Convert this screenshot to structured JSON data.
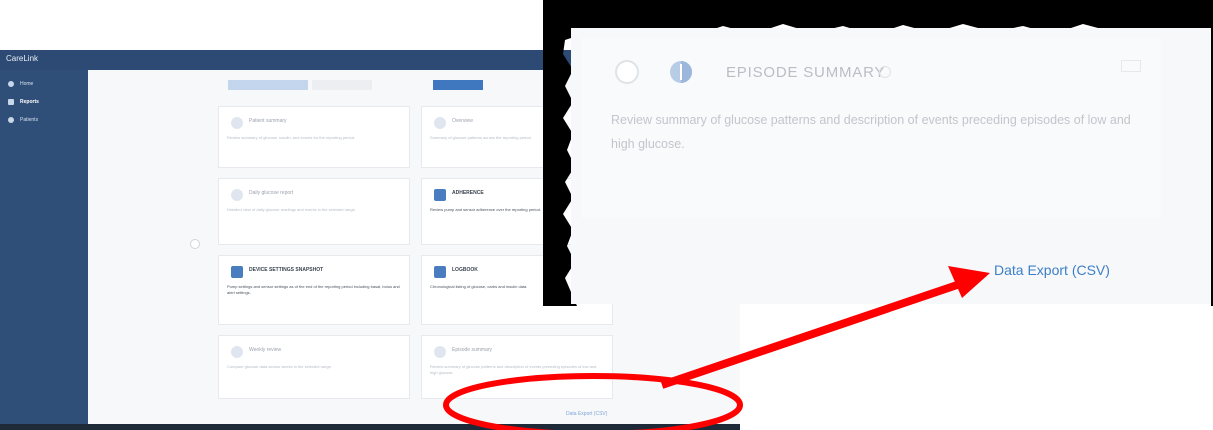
{
  "app": {
    "brand": "CareLink",
    "sidebar": [
      {
        "label": "Home"
      },
      {
        "label": "Reports"
      },
      {
        "label": "Patients"
      }
    ],
    "cards": [
      {
        "title": "Patient summary",
        "desc": "Review summary of glucose, insulin, and events for the reporting period.",
        "active": false
      },
      {
        "title": "Overview",
        "desc": "Summary of glucose patterns across the reporting period.",
        "active": false
      },
      {
        "title": "Daily glucose report",
        "desc": "Detailed view of daily glucose readings and events in the selected range.",
        "active": false
      },
      {
        "title": "ADHERENCE",
        "desc": "Review pump and sensor adherence over the reporting period.",
        "active": true
      },
      {
        "title": "DEVICE SETTINGS SNAPSHOT",
        "desc": "Pump settings and sensor settings as of the end of the reporting period including basal, bolus and alert settings.",
        "active": true
      },
      {
        "title": "LOGBOOK",
        "desc": "Chronological listing of glucose, carbs and insulin data.",
        "active": true
      },
      {
        "title": "Weekly review",
        "desc": "Compare glucose data across weeks in the selected range.",
        "active": false
      },
      {
        "title": "Episode summary",
        "desc": "Review summary of glucose patterns and description of events preceding episodes of low and high glucose.",
        "active": false
      }
    ],
    "export_small": "Data Export (CSV)"
  },
  "inset": {
    "title": "EPISODE SUMMARY",
    "description": "Review summary of glucose patterns and description of events preceding episodes of low and high glucose.",
    "data_export": "Data Export (CSV)"
  },
  "colors": {
    "sidebar": "#2f4e78",
    "link": "#3d7fc7",
    "annotation": "#ff0000"
  }
}
